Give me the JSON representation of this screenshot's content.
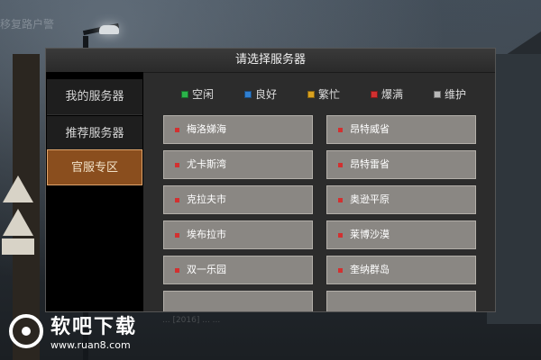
{
  "background": {
    "top_left_text": "移复路户警",
    "footer_text": "... [2016] ... ..."
  },
  "dialog": {
    "title": "请选择服务器",
    "sidebar": [
      {
        "label": "我的服务器",
        "active": false
      },
      {
        "label": "推荐服务器",
        "active": false
      },
      {
        "label": "官服专区",
        "active": true
      }
    ],
    "legend": [
      {
        "label": "空闲",
        "color": "#2bb34a"
      },
      {
        "label": "良好",
        "color": "#2f7fd1"
      },
      {
        "label": "繁忙",
        "color": "#d9a11f"
      },
      {
        "label": "爆满",
        "color": "#d23030"
      },
      {
        "label": "维护",
        "color": "#b9b9b9"
      }
    ],
    "servers": [
      {
        "name": "梅洛娣海",
        "status": "爆满"
      },
      {
        "name": "昂特威省",
        "status": "爆满"
      },
      {
        "name": "尤卡斯湾",
        "status": "爆满"
      },
      {
        "name": "昂特雷省",
        "status": "爆满"
      },
      {
        "name": "克拉夫市",
        "status": "爆满"
      },
      {
        "name": "奥逊平原",
        "status": "爆满"
      },
      {
        "name": "埃布拉市",
        "status": "爆满"
      },
      {
        "name": "莱博沙漠",
        "status": "爆满"
      },
      {
        "name": "双一乐园",
        "status": "爆满"
      },
      {
        "name": "奎纳群岛",
        "status": "爆满"
      }
    ],
    "status_color": "#d23030"
  },
  "watermark": {
    "brand": "软吧下载",
    "url": "www.ruan8.com"
  }
}
